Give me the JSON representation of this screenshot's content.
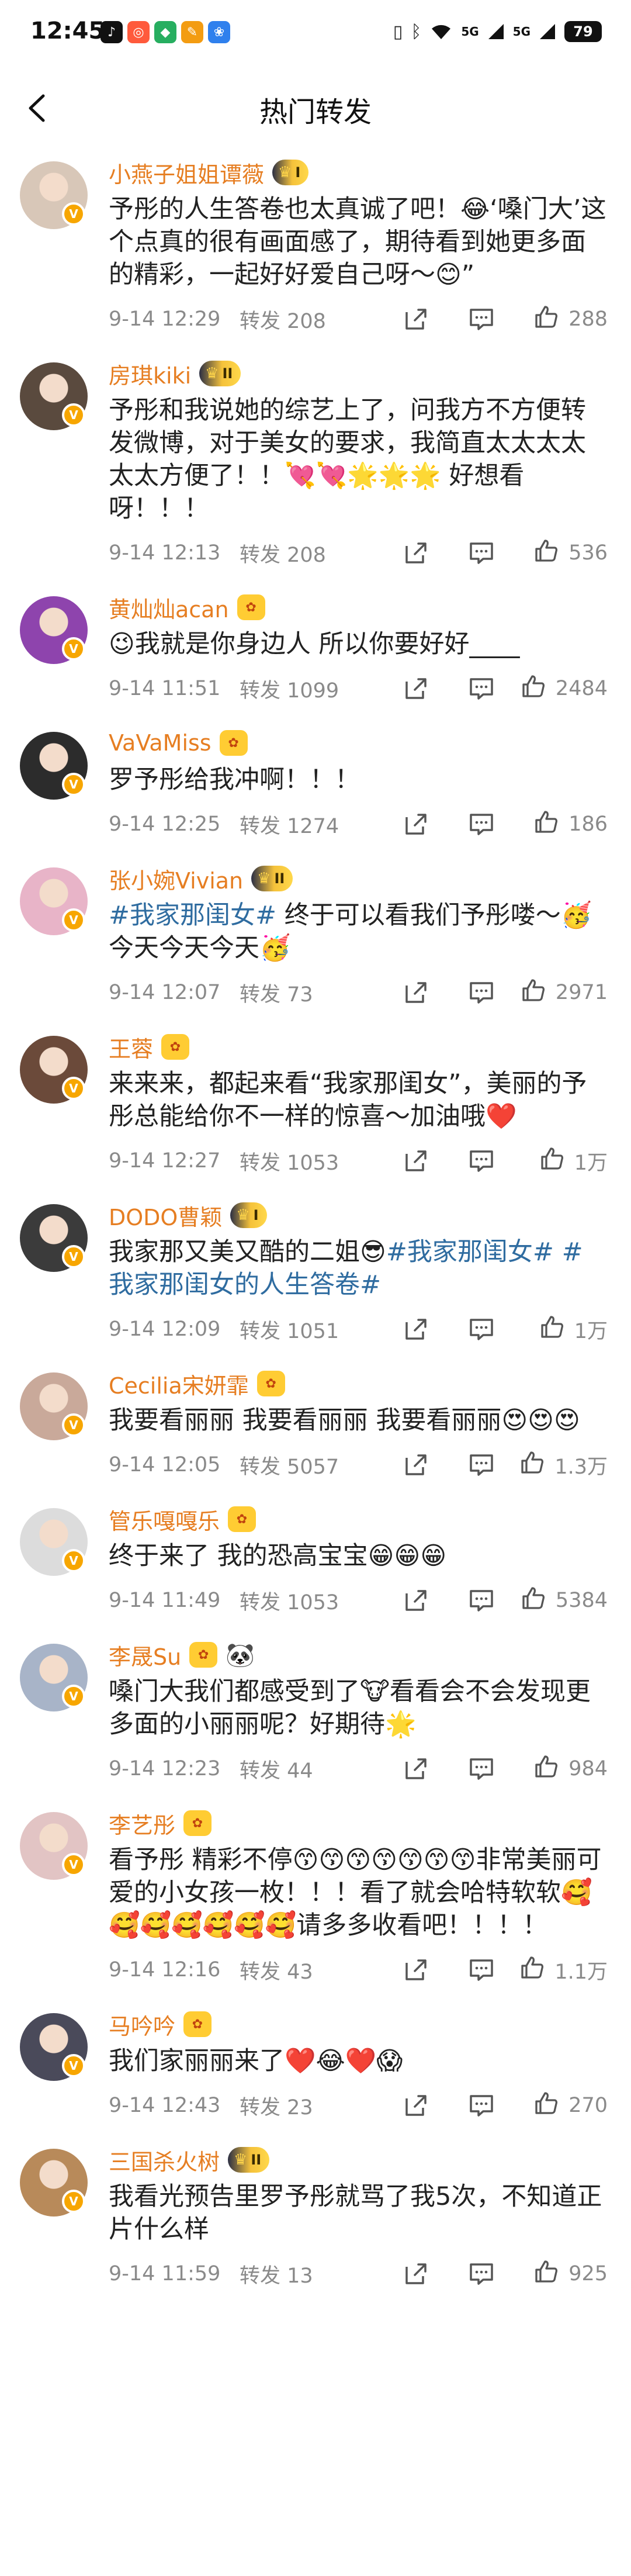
{
  "status_bar": {
    "time": "12:45",
    "app_icons": [
      {
        "name": "tiktok-icon",
        "glyph": "♪",
        "color": "#111111"
      },
      {
        "name": "red-app-icon",
        "glyph": "◎",
        "color": "#ff5a3c"
      },
      {
        "name": "green-app-icon",
        "glyph": "◆",
        "color": "#27ae60"
      },
      {
        "name": "orange-app-icon",
        "glyph": "✎",
        "color": "#f39c12"
      },
      {
        "name": "paw-icon",
        "glyph": "❀",
        "color": "#2f80ed"
      }
    ],
    "signal_1": "5G",
    "signal_2": "5G",
    "battery": "79"
  },
  "header": {
    "title": "热门转发"
  },
  "colors": {
    "username": "#e67e22",
    "topic": "#2f6ca0",
    "meta": "#8a8a8a"
  },
  "reposts": [
    {
      "name": "小燕子姐姐谭薇",
      "badge": "I",
      "text": "予彤的人生答卷也太真诚了吧！😂‘嗓门大’这个点真的很有画面感了，期待看到她更多面的精彩，一起好好爱自己呀～😊”",
      "time": "9-14 12:29",
      "reposts": "转发 208",
      "likes": "288",
      "avatar": "#d8c7b8"
    },
    {
      "name": "房琪kiki",
      "badge": "II",
      "text": "予彤和我说她的综艺上了，问我方不方便转发微博，对于美女的要求，我简直太太太太太太方便了！！💘💘🌟🌟🌟 好想看呀！！！",
      "time": "9-14 12:13",
      "reposts": "转发 208",
      "likes": "536",
      "avatar": "#5a4a3e"
    },
    {
      "name": "黄灿灿acan",
      "badge": "",
      "text": "😉我就是你身边人 所以你要好好____",
      "time": "9-14 11:51",
      "reposts": "转发 1099",
      "likes": "2484",
      "avatar": "#8e44ad"
    },
    {
      "name": "VaVaMiss",
      "badge": "",
      "text": "罗予彤给我冲啊！！！",
      "time": "9-14 12:25",
      "reposts": "转发 1274",
      "likes": "186",
      "avatar": "#2c2c2c"
    },
    {
      "name": "张小婉Vivian",
      "badge": "II",
      "text": "#我家那闺女# 终于可以看我们予彤喽～🥳今天今天今天🥳",
      "time": "9-14 12:07",
      "reposts": "转发 73",
      "likes": "2971",
      "avatar": "#e8b4c8"
    },
    {
      "name": "王蓉",
      "badge": "",
      "text": "来来来，都起来看“我家那闺女”，美丽的予彤总能给你不一样的惊喜～加油哦❤️",
      "time": "9-14 12:27",
      "reposts": "转发 1053",
      "likes": "1万",
      "avatar": "#6b4a3a"
    },
    {
      "name": "DODO曹颖",
      "badge": "I",
      "text": "我家那又美又酷的二姐😎#我家那闺女# #我家那闺女的人生答卷#",
      "time": "9-14 12:09",
      "reposts": "转发 1051",
      "likes": "1万",
      "avatar": "#3b3b3b"
    },
    {
      "name": "Cecilia宋妍霏",
      "badge": "",
      "text": "我要看丽丽 我要看丽丽 我要看丽丽😍😍😍",
      "time": "9-14 12:05",
      "reposts": "转发 5057",
      "likes": "1.3万",
      "avatar": "#c9a99a"
    },
    {
      "name": "管乐嘎嘎乐",
      "badge": "",
      "text": "终于来了 我的恐高宝宝😁😁😁",
      "time": "9-14 11:49",
      "reposts": "转发 1053",
      "likes": "5384",
      "avatar": "#dcdcdc"
    },
    {
      "name": "李晟Su",
      "badge": "",
      "panda": "🐼",
      "text": "嗓门大我们都感受到了🐮看看会不会发现更多面的小丽丽呢？好期待🌟",
      "time": "9-14 12:23",
      "reposts": "转发 44",
      "likes": "984",
      "avatar": "#a8b4c8"
    },
    {
      "name": "李艺彤",
      "badge": "",
      "text": "看予彤 精彩不停😙😙😙😙😙😙😙非常美丽可爱的小女孩一枚！！！看了就会哈特软软🥰🥰🥰🥰🥰🥰🥰请多多收看吧！！！！",
      "time": "9-14 12:16",
      "reposts": "转发 43",
      "likes": "1.1万",
      "avatar": "#e2c4c4"
    },
    {
      "name": "马吟吟",
      "badge": "",
      "text": "我们家丽丽来了❤️😂❤️😱",
      "time": "9-14 12:43",
      "reposts": "转发 23",
      "likes": "270",
      "avatar": "#4a4a5a"
    },
    {
      "name": "三国杀火树",
      "badge": "II",
      "text": "我看光预告里罗予彤就骂了我5次，不知道正片什么样",
      "time": "9-14 11:59",
      "reposts": "转发 13",
      "likes": "925",
      "avatar": "#b88a5a"
    }
  ]
}
